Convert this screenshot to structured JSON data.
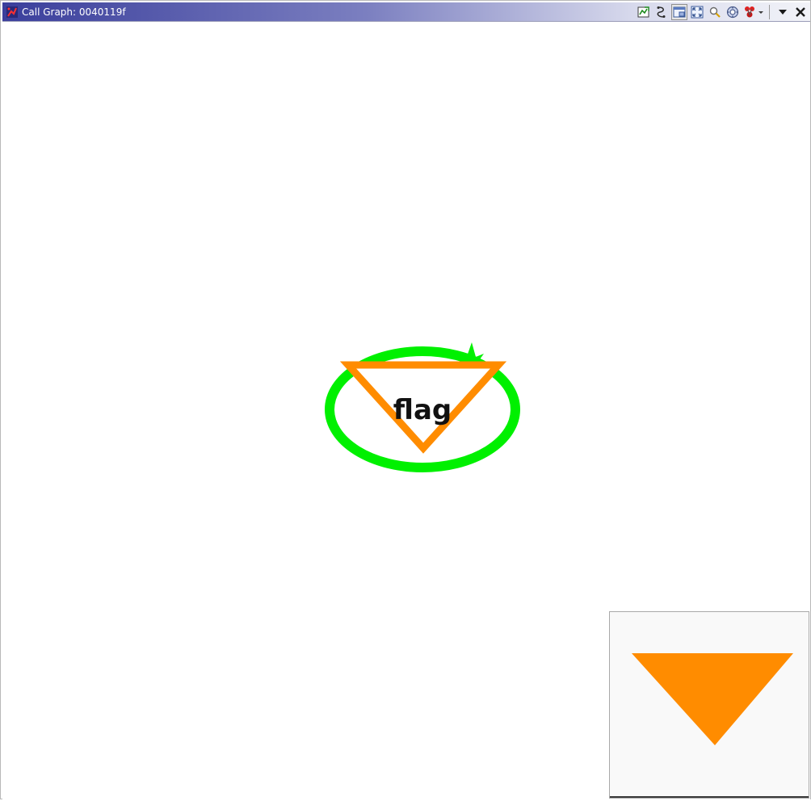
{
  "window": {
    "title": "Call Graph: 0040119f"
  },
  "toolbar": {
    "buttons": [
      {
        "name": "refresh-graph-button",
        "icon": "graph-refresh-icon"
      },
      {
        "name": "layout-button",
        "icon": "layout-icon"
      },
      {
        "name": "satellite-view-button",
        "icon": "satellite-view-icon",
        "pressed": true
      },
      {
        "name": "zoom-to-fit-button",
        "icon": "fit-window-icon"
      },
      {
        "name": "zoom-button",
        "icon": "magnifier-icon"
      },
      {
        "name": "options-button",
        "icon": "options-icon"
      },
      {
        "name": "graph-type-button",
        "icon": "graph-type-icon"
      }
    ],
    "menu_icon": "chevron-down-icon",
    "close_icon": "close-icon"
  },
  "graph": {
    "node_label": "flag",
    "colors": {
      "ellipse": "#00f000",
      "triangle": "#ff8c00",
      "text": "#111111",
      "overview_fill": "#ff8c00"
    }
  }
}
